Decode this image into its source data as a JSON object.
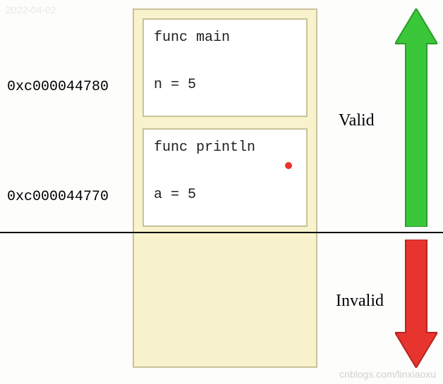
{
  "watermarks": {
    "top_left": "2022-04-02",
    "bottom_left": "",
    "bottom_right": "cnblogs.com/linxiaoxu"
  },
  "addresses": {
    "addr1": "0xc000044780",
    "addr2": "0xc000044770"
  },
  "frames": {
    "frame1": {
      "title": "func main",
      "value": "n = 5"
    },
    "frame2": {
      "title": "func println",
      "value": "a = 5"
    }
  },
  "labels": {
    "valid": "Valid",
    "invalid": "Invalid"
  },
  "colors": {
    "stack_bg": "#f8f3cd",
    "stack_border": "#c9c29a",
    "green_arrow": "#3ac73a",
    "green_arrow_stroke": "#2a9d2a",
    "red_arrow": "#e8342f",
    "red_arrow_stroke": "#b5241f",
    "red_dot": "#e8342f"
  }
}
